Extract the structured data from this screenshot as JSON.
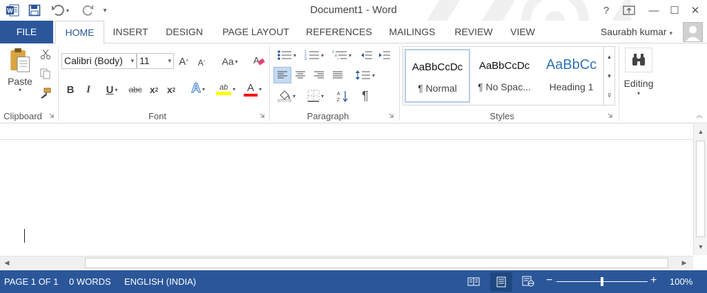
{
  "window": {
    "title": "Document1 - Word"
  },
  "quick_access": {
    "customize_symbol": "▾"
  },
  "window_controls": {
    "help": "?",
    "minimize": "—",
    "maximize": "☐",
    "close": "✕"
  },
  "tabs": [
    {
      "id": "file",
      "label": "FILE"
    },
    {
      "id": "home",
      "label": "HOME"
    },
    {
      "id": "insert",
      "label": "INSERT"
    },
    {
      "id": "design",
      "label": "DESIGN"
    },
    {
      "id": "page-layout",
      "label": "PAGE LAYOUT"
    },
    {
      "id": "references",
      "label": "REFERENCES"
    },
    {
      "id": "mailings",
      "label": "MAILINGS"
    },
    {
      "id": "review",
      "label": "REVIEW"
    },
    {
      "id": "view",
      "label": "VIEW"
    }
  ],
  "user": {
    "name": "Saurabh kumar"
  },
  "ribbon": {
    "clipboard": {
      "paste_label": "Paste",
      "group_label": "Clipboard"
    },
    "font": {
      "font_name": "Calibri (Body)",
      "font_size": "11",
      "grow_label": "A",
      "shrink_label": "A",
      "case_label": "Aa",
      "bold": "B",
      "italic": "I",
      "underline": "U",
      "strike": "abc",
      "subscript": "x",
      "subscript_sub": "2",
      "superscript": "x",
      "superscript_sup": "2",
      "effects": "A",
      "highlight": "ab",
      "font_color": "A",
      "group_label": "Font"
    },
    "paragraph": {
      "pilcrow": "¶",
      "group_label": "Paragraph"
    },
    "styles": {
      "items": [
        {
          "preview": "AaBbCcDc",
          "name": "¶ Normal"
        },
        {
          "preview": "AaBbCcDc",
          "name": "¶ No Spac..."
        },
        {
          "preview": "AaBbCc",
          "name": "Heading 1"
        }
      ],
      "group_label": "Styles"
    },
    "editing": {
      "label": "Editing"
    }
  },
  "status": {
    "page": "PAGE 1 OF 1",
    "words": "0 WORDS",
    "language": "ENGLISH (INDIA)",
    "zoom_out": "−",
    "zoom_in": "+",
    "zoom": "100%",
    "zoom_level": 0.5
  },
  "colors": {
    "accent": "#2b579a",
    "highlight": "#ffff00",
    "font_color": "#ff0000",
    "heading": "#2e74b5"
  }
}
